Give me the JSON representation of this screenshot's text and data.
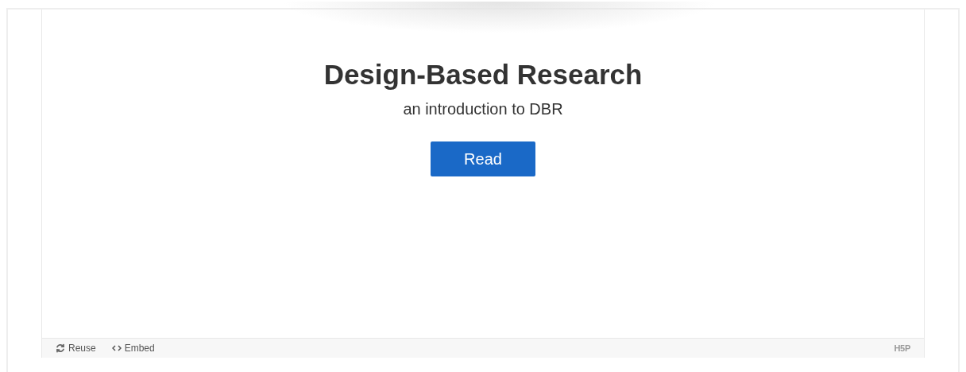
{
  "title": "Design-Based Research",
  "subtitle": "an introduction to DBR",
  "read_button": "Read",
  "footer": {
    "actions": [
      {
        "kind": "reuse",
        "label": "Reuse"
      },
      {
        "kind": "embed",
        "label": "Embed"
      }
    ],
    "logo": "H5P"
  }
}
